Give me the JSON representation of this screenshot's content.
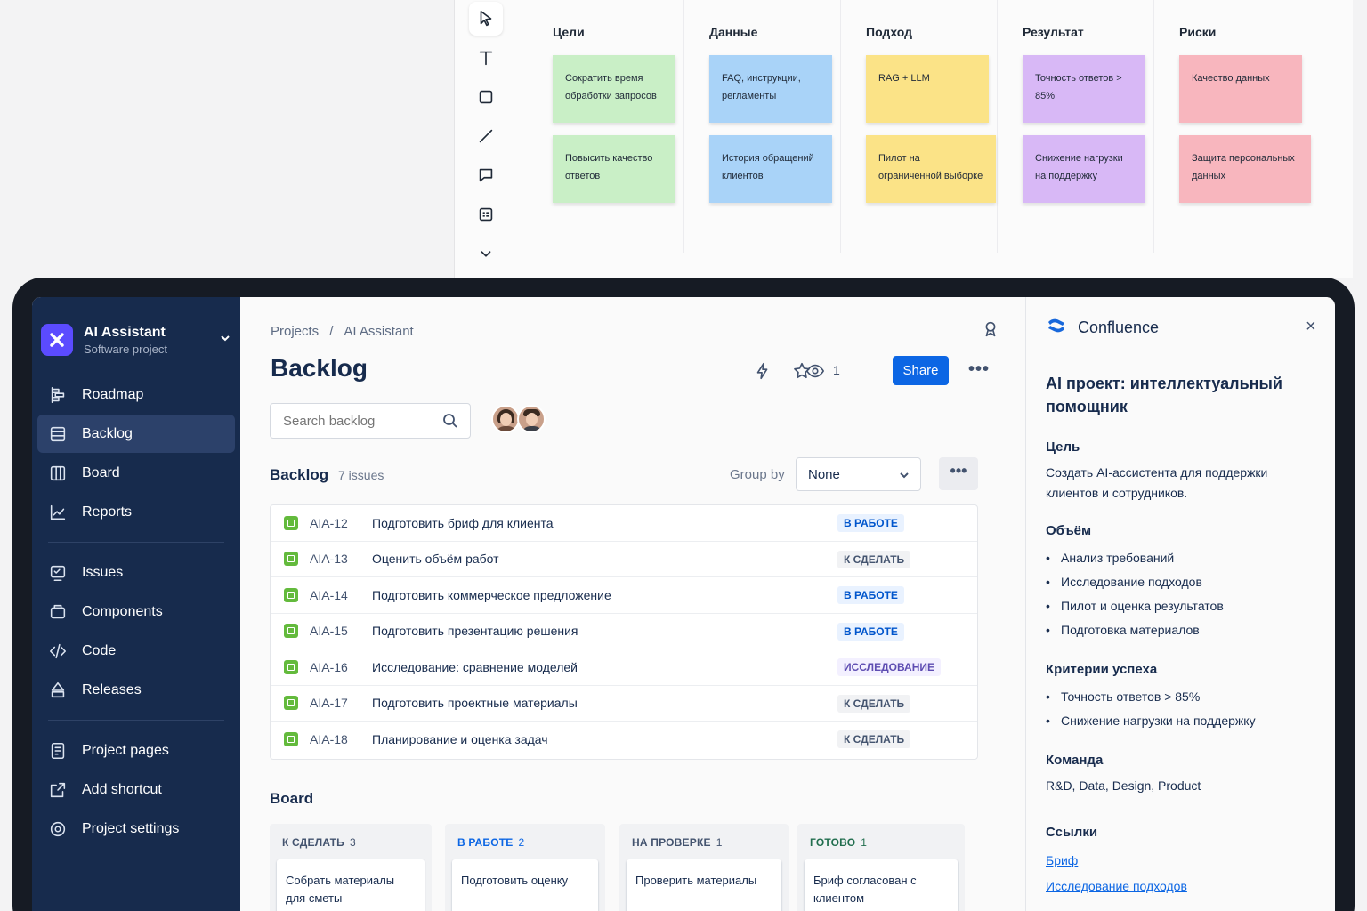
{
  "whiteboard": {
    "columns": [
      {
        "title": "Цели",
        "notes": [
          {
            "text": "Сократить время обработки запросов",
            "color": "g"
          },
          {
            "text": "Повысить качество ответов",
            "color": "g"
          }
        ]
      },
      {
        "title": "Данные",
        "notes": [
          {
            "text": "FAQ, инструкции, регламенты",
            "color": "b"
          },
          {
            "text": "История обращений клиентов",
            "color": "b"
          }
        ]
      },
      {
        "title": "Подход",
        "notes": [
          {
            "text": "RAG + LLM",
            "color": "y"
          },
          {
            "text": "Пилот на ограниченной выборке",
            "color": "y"
          }
        ]
      },
      {
        "title": "Результат",
        "notes": [
          {
            "text": "Точность ответов > 85%",
            "color": "p"
          },
          {
            "text": "Снижение нагрузки на поддержку",
            "color": "p"
          }
        ]
      },
      {
        "title": "Риски",
        "notes": [
          {
            "text": "Качество данных",
            "color": "r"
          },
          {
            "text": "Защита персональных данных",
            "color": "r"
          }
        ]
      }
    ]
  },
  "sidebar": {
    "project_name": "AI Assistant",
    "project_type": "Software project",
    "items": [
      {
        "label": "Roadmap",
        "icon": "roadmap-icon"
      },
      {
        "label": "Backlog",
        "icon": "backlog-icon"
      },
      {
        "label": "Board",
        "icon": "board-icon"
      },
      {
        "label": "Reports",
        "icon": "reports-icon"
      },
      {
        "label": "Issues",
        "icon": "issues-icon"
      },
      {
        "label": "Components",
        "icon": "components-icon"
      },
      {
        "label": "Code",
        "icon": "code-icon"
      },
      {
        "label": "Releases",
        "icon": "releases-icon"
      },
      {
        "label": "Project pages",
        "icon": "pages-icon"
      },
      {
        "label": "Add shortcut",
        "icon": "shortcut-icon"
      },
      {
        "label": "Project settings",
        "icon": "settings-icon"
      }
    ]
  },
  "main": {
    "breadcrumb": {
      "root": "Projects",
      "separator": "/",
      "current": "AI Assistant"
    },
    "title": "Backlog",
    "watchers": "1",
    "share_label": "Share",
    "search_placeholder": "Search backlog",
    "backlog": {
      "title": "Backlog",
      "count": "7 issues",
      "group_by_label": "Group by",
      "group_by_value": "None",
      "issues": [
        {
          "key": "AIA-12",
          "summary": "Подготовить бриф для клиента",
          "status": "В РАБОТЕ",
          "kind": "inprog"
        },
        {
          "key": "AIA-13",
          "summary": "Оценить объём работ",
          "status": "К СДЕЛАТЬ",
          "kind": "todo"
        },
        {
          "key": "AIA-14",
          "summary": "Подготовить коммерческое предложение",
          "status": "В РАБОТЕ",
          "kind": "inprog"
        },
        {
          "key": "AIA-15",
          "summary": "Подготовить презентацию решения",
          "status": "В РАБОТЕ",
          "kind": "inprog"
        },
        {
          "key": "AIA-16",
          "summary": "Исследование: сравнение моделей",
          "status": "ИССЛЕДОВАНИЕ",
          "kind": "research"
        },
        {
          "key": "AIA-17",
          "summary": "Подготовить проектные материалы",
          "status": "К СДЕЛАТЬ",
          "kind": "todo"
        },
        {
          "key": "AIA-18",
          "summary": "Планирование и оценка задач",
          "status": "К СДЕЛАТЬ",
          "kind": "todo"
        }
      ]
    },
    "board": {
      "title": "Board",
      "columns": [
        {
          "name": "К СДЕЛАТЬ",
          "count": "3",
          "card": "Собрать материалы для сметы",
          "tone": ""
        },
        {
          "name": "В РАБОТЕ",
          "count": "2",
          "card": "Подготовить оценку",
          "tone": "blue"
        },
        {
          "name": "НА ПРОВЕРКЕ",
          "count": "1",
          "card": "Проверить материалы",
          "tone": ""
        },
        {
          "name": "ГОТОВО",
          "count": "1",
          "card": "Бриф согласован с клиентом",
          "tone": "green"
        }
      ]
    }
  },
  "confluence": {
    "app_name": "Confluence",
    "close_label": "×",
    "page_title": "AI проект: интеллектуальный помощник",
    "goal_heading": "Цель",
    "goal_text": "Создать AI-ассистента для поддержки клиентов и сотрудников.",
    "scope_heading": "Объём",
    "scope_items": [
      "Анализ требований",
      "Исследование подходов",
      "Пилот и оценка результатов",
      "Подготовка материалов"
    ],
    "criteria_heading": "Критерии успеха",
    "criteria_items": [
      "Точность ответов > 85%",
      "Снижение нагрузки на поддержку"
    ],
    "team_heading": "Команда",
    "team_text": "R&D, Data, Design, Product",
    "links_heading": "Ссылки",
    "links": [
      "Бриф",
      "Исследование подходов"
    ]
  },
  "colors": {
    "sidebar": "#172b4d",
    "accent": "#0c66e4",
    "logo": "#5b4bff"
  }
}
